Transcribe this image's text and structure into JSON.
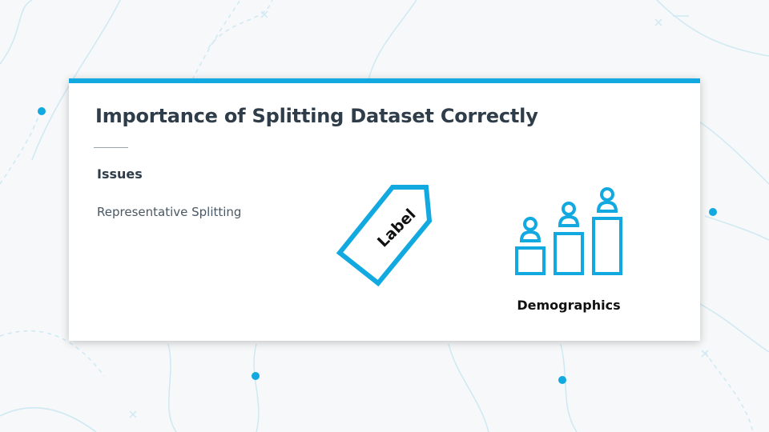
{
  "slide": {
    "title": "Importance of Splitting Dataset Correctly",
    "section_heading": "Issues",
    "items": [
      "Representative Splitting"
    ]
  },
  "graphics": {
    "tag_label": "Label",
    "demographics_label": "Demographics",
    "tag_icon": "tag-icon",
    "demographics_icon": "demographics-icon"
  },
  "colors": {
    "accent": "#11a9df",
    "title_text": "#2e3d49",
    "background": "#f6f8f9",
    "decor_lines": "#cfe9f3"
  }
}
